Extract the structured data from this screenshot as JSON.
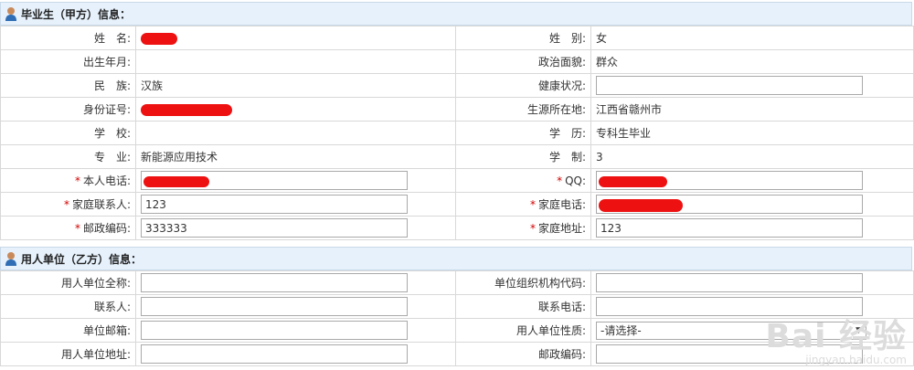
{
  "section1": {
    "title": "毕业生（甲方）信息：",
    "rows": [
      {
        "l1": "姓　名:",
        "v1": "",
        "l2": "姓　别:",
        "v2": "女"
      },
      {
        "l1": "出生年月:",
        "v1": "",
        "l2": "政治面貌:",
        "v2": "群众"
      },
      {
        "l1": "民　族:",
        "v1": "汉族",
        "l2": "健康状况:",
        "v2": ""
      },
      {
        "l1": "身份证号:",
        "v1": "",
        "l2": "生源所在地:",
        "v2": "江西省赣州市"
      },
      {
        "l1": "学　校:",
        "v1": "",
        "l2": "学　历:",
        "v2": "专科生毕业"
      },
      {
        "l1": "专　业:",
        "v1": "新能源应用技术",
        "l2": "学　制:",
        "v2": "3"
      },
      {
        "l1": "本人电话:",
        "v1": "",
        "l2": "QQ:",
        "v2": ""
      },
      {
        "l1": "家庭联系人:",
        "v1": "123",
        "l2": "家庭电话:",
        "v2": ""
      },
      {
        "l1": "邮政编码:",
        "v1": "333333",
        "l2": "家庭地址:",
        "v2": "123"
      }
    ]
  },
  "section2": {
    "title": "用人单位（乙方）信息：",
    "rows": [
      {
        "l1": "用人单位全称:",
        "v1": "",
        "l2": "单位组织机构代码:",
        "v2": ""
      },
      {
        "l1": "联系人:",
        "v1": "",
        "l2": "联系电话:",
        "v2": ""
      },
      {
        "l1": "单位邮箱:",
        "v1": "",
        "l2": "用人单位性质:",
        "v2": "-请选择-"
      },
      {
        "l1": "用人单位地址:",
        "v1": "",
        "l2": "邮政编码:",
        "v2": ""
      }
    ]
  },
  "required_mark": "*",
  "watermark": {
    "big": "Bai 经验",
    "small": "jingyan.baidu.com"
  }
}
